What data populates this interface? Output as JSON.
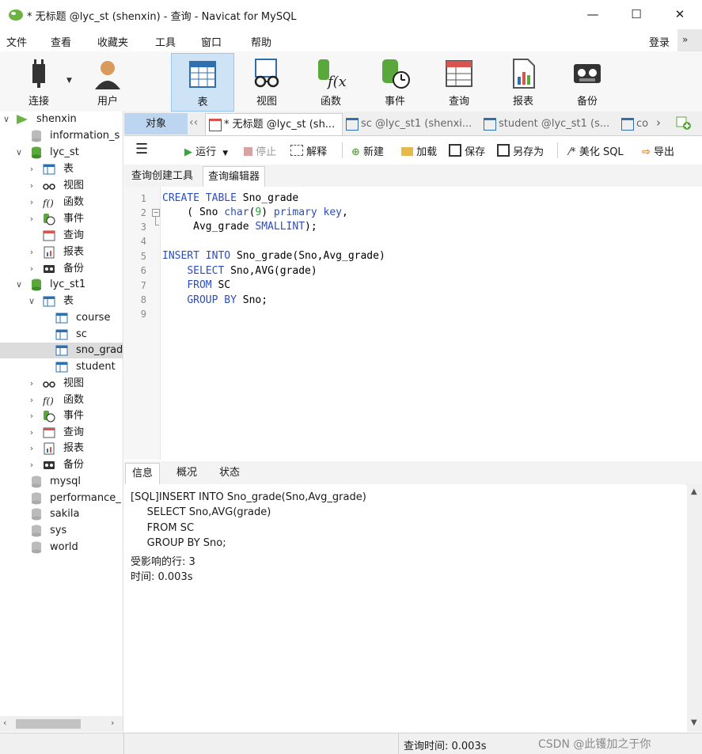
{
  "window": {
    "title": "* 无标题 @lyc_st (shenxin) - 查询 - Navicat for MySQL",
    "minimize": "—",
    "maximize": "☐",
    "close": "✕"
  },
  "menu": {
    "items": [
      "文件",
      "查看",
      "收藏夹",
      "工具",
      "窗口",
      "帮助"
    ],
    "login": "登录"
  },
  "toolbar": {
    "connect": "连接",
    "user": "用户",
    "table": "表",
    "view": "视图",
    "function": "函数",
    "event": "事件",
    "query": "查询",
    "report": "报表",
    "backup": "备份"
  },
  "tree": {
    "connection": "shenxin",
    "information_schema": "information_s",
    "db1": "lyc_st",
    "db1_items": [
      "表",
      "视图",
      "函数",
      "事件",
      "查询",
      "报表",
      "备份"
    ],
    "db2": "lyc_st1",
    "db2_table_group": "表",
    "db2_tables": [
      "course",
      "sc",
      "sno_grad",
      "student"
    ],
    "db2_items": [
      "视图",
      "函数",
      "事件",
      "查询",
      "报表",
      "备份"
    ],
    "other_dbs": [
      "mysql",
      "performance_",
      "sakila",
      "sys",
      "world"
    ]
  },
  "tabs": {
    "objects": "对象",
    "tab1": "* 无标题 @lyc_st (sh...",
    "tab2": "sc @lyc_st1 (shenxi...",
    "tab3": "student @lyc_st1 (s...",
    "tab4": "co"
  },
  "query_toolbar": {
    "run": "运行",
    "stop": "停止",
    "explain": "解释",
    "new": "新建",
    "load": "加载",
    "save": "保存",
    "save_as": "另存为",
    "beautify": "美化 SQL",
    "export": "导出"
  },
  "subtabs": {
    "builder": "查询创建工具",
    "editor": "查询编辑器"
  },
  "editor": {
    "line_numbers": [
      "1",
      "2",
      "3",
      "4",
      "5",
      "6",
      "7",
      "8",
      "9"
    ]
  },
  "bottom_tabs": {
    "info": "信息",
    "profile": "概况",
    "status": "状态"
  },
  "info": {
    "lines": [
      "[SQL]INSERT INTO Sno_grade(Sno,Avg_grade)",
      "     SELECT Sno,AVG(grade)",
      "     FROM SC",
      "     GROUP BY Sno;",
      "受影响的行: 3",
      "时间: 0.003s"
    ]
  },
  "status": {
    "query_time": "查询时间: 0.003s",
    "watermark": "CSDN @此镬加之于你"
  }
}
